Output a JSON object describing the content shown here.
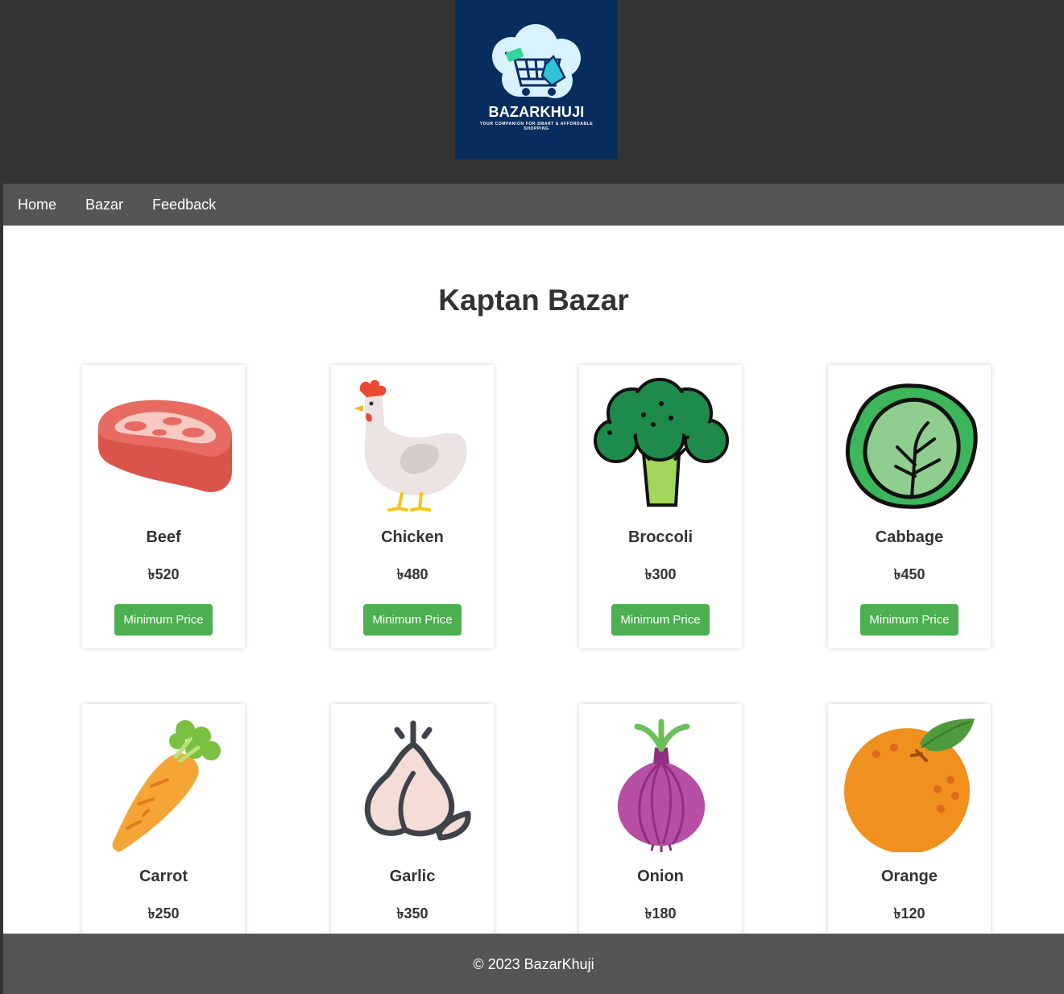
{
  "logo": {
    "title": "BAZARKHUJI",
    "tagline": "YOUR COMPANION FOR SMART & AFFORDABLE SHOPPING"
  },
  "nav": {
    "items": [
      {
        "label": "Home"
      },
      {
        "label": "Bazar"
      },
      {
        "label": "Feedback"
      }
    ]
  },
  "main": {
    "title": "Kaptan Bazar",
    "button_label": "Minimum Price",
    "products": [
      {
        "name": "Beef",
        "price": "৳520",
        "icon": "beef-steak-icon"
      },
      {
        "name": "Chicken",
        "price": "৳480",
        "icon": "chicken-icon"
      },
      {
        "name": "Broccoli",
        "price": "৳300",
        "icon": "broccoli-icon"
      },
      {
        "name": "Cabbage",
        "price": "৳450",
        "icon": "cabbage-icon"
      },
      {
        "name": "Carrot",
        "price": "৳250",
        "icon": "carrot-icon"
      },
      {
        "name": "Garlic",
        "price": "৳350",
        "icon": "garlic-icon"
      },
      {
        "name": "Onion",
        "price": "৳180",
        "icon": "onion-icon"
      },
      {
        "name": "Orange",
        "price": "৳120",
        "icon": "orange-icon"
      }
    ]
  },
  "footer": {
    "text": "© 2023 BazarKhuji"
  },
  "colors": {
    "header_bg": "#333333",
    "nav_bg": "#555555",
    "logo_bg": "#072d5f",
    "button_bg": "#4caf50"
  }
}
